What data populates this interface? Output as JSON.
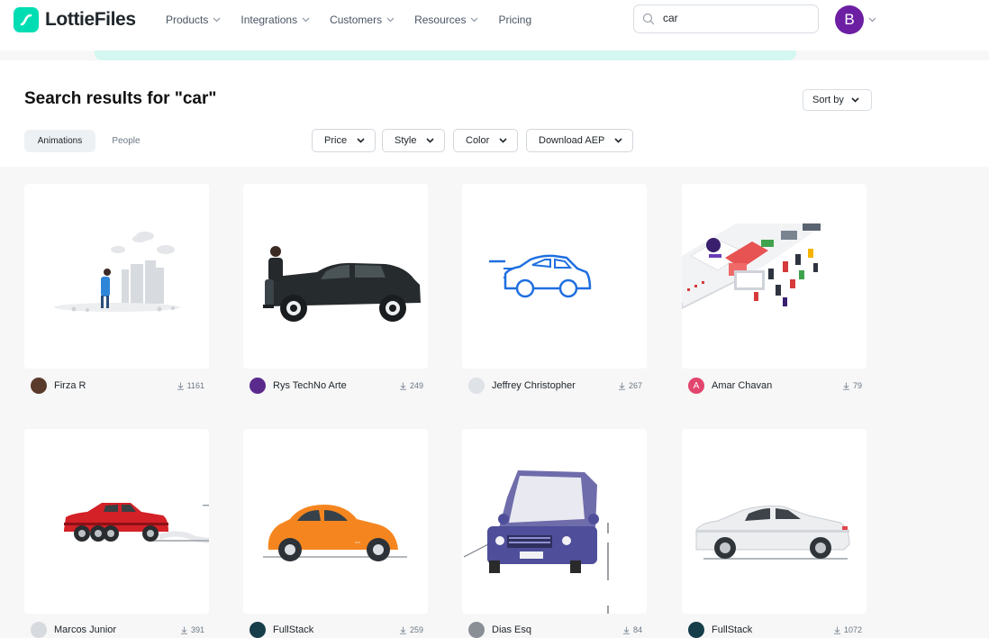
{
  "brand": {
    "name": "LottieFiles",
    "color": "#00ddb3"
  },
  "nav": {
    "items": [
      {
        "label": "Products",
        "has_dropdown": true
      },
      {
        "label": "Integrations",
        "has_dropdown": true
      },
      {
        "label": "Customers",
        "has_dropdown": true
      },
      {
        "label": "Resources",
        "has_dropdown": true
      },
      {
        "label": "Pricing",
        "has_dropdown": false
      }
    ]
  },
  "search": {
    "value": "car",
    "icon": "search-icon"
  },
  "user": {
    "initial": "B",
    "color": "#6d1fa3"
  },
  "page": {
    "title": "Search results for \"car\"",
    "sort_label": "Sort by"
  },
  "tabs": [
    {
      "label": "Animations",
      "active": true
    },
    {
      "label": "People",
      "active": false
    }
  ],
  "filters": [
    {
      "label": "Price"
    },
    {
      "label": "Style"
    },
    {
      "label": "Color"
    },
    {
      "label": "Download AEP"
    }
  ],
  "results": [
    {
      "author": "Firza R",
      "downloads": "1161"
    },
    {
      "author": "Rys TechNo Arte",
      "downloads": "249"
    },
    {
      "author": "Jeffrey Christopher",
      "downloads": "267"
    },
    {
      "author": "Amar Chavan",
      "downloads": "79",
      "avatar_initial": "A"
    },
    {
      "author": "Marcos Junior",
      "downloads": "391"
    },
    {
      "author": "FullStack",
      "downloads": "259"
    },
    {
      "author": "Dias Esq",
      "downloads": "84"
    },
    {
      "author": "FullStack",
      "downloads": "1072"
    }
  ]
}
